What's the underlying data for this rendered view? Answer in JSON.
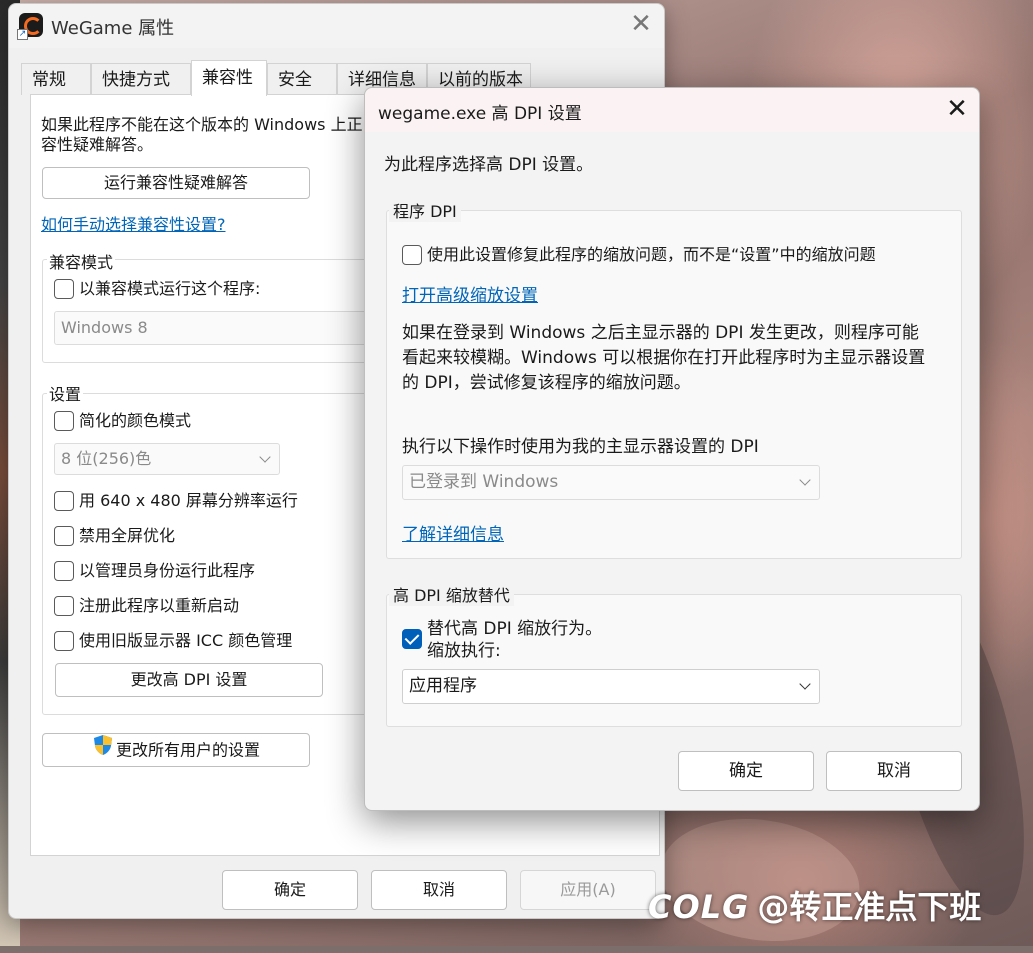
{
  "properties_window": {
    "title": "WeGame 属性",
    "tabs": [
      {
        "label": "常规"
      },
      {
        "label": "快捷方式"
      },
      {
        "label": "兼容性"
      },
      {
        "label": "安全"
      },
      {
        "label": "详细信息"
      },
      {
        "label": "以前的版本"
      }
    ],
    "intro_line1": "如果此程序不能在这个版本的 Windows 上正常",
    "intro_line2": "容性疑难解答。",
    "troubleshoot_button": "运行兼容性疑难解答",
    "manual_link": "如何手动选择兼容性设置?",
    "compat_mode": {
      "group_label": "兼容模式",
      "checkbox_label": "以兼容模式运行这个程序:",
      "checked": false,
      "selected_os": "Windows 8"
    },
    "settings": {
      "group_label": "设置",
      "reduced_color": {
        "label": "简化的颜色模式",
        "checked": false
      },
      "color_select": "8 位(256)色",
      "res_640": {
        "label": "用 640 x 480 屏幕分辨率运行",
        "checked": false
      },
      "disable_fullscreen": {
        "label": "禁用全屏优化",
        "checked": false
      },
      "run_as_admin": {
        "label": "以管理员身份运行此程序",
        "checked": false
      },
      "register_restart": {
        "label": "注册此程序以重新启动",
        "checked": false
      },
      "legacy_icc": {
        "label": "使用旧版显示器 ICC 颜色管理",
        "checked": false
      },
      "change_dpi_button": "更改高 DPI 设置"
    },
    "all_users_button": "更改所有用户的设置",
    "footer": {
      "ok": "确定",
      "cancel": "取消",
      "apply": "应用(A)"
    }
  },
  "dpi_dialog": {
    "title": "wegame.exe 高 DPI 设置",
    "heading": "为此程序选择高 DPI 设置。",
    "program_dpi": {
      "group_label": "程序 DPI",
      "checkbox_label": "使用此设置修复此程序的缩放问题，而不是“设置”中的缩放问题",
      "checked": false,
      "advanced_link": "打开高级缩放设置",
      "desc_line1": "如果在登录到 Windows 之后主显示器的 DPI 发生更改，则程序可能",
      "desc_line2": "看起来较模糊。Windows 可以根据你在打开此程序时为主显示器设置",
      "desc_line3": "的 DPI，尝试修复该程序的缩放问题。",
      "use_dpi_label": "执行以下操作时使用为我的主显示器设置的 DPI",
      "use_dpi_select": "已登录到 Windows",
      "learn_more_link": "了解详细信息"
    },
    "override": {
      "group_label": "高 DPI 缩放替代",
      "checkbox_label": "替代高 DPI 缩放行为。",
      "checked": true,
      "scaling_label": "缩放执行:",
      "scaling_select": "应用程序"
    },
    "footer": {
      "ok": "确定",
      "cancel": "取消"
    }
  },
  "watermark": {
    "logo": "COLG",
    "text": "@转正准点下班"
  },
  "colors": {
    "accent": "#005fb8",
    "link": "#0065b8",
    "window_bg": "#f0f0f0"
  }
}
